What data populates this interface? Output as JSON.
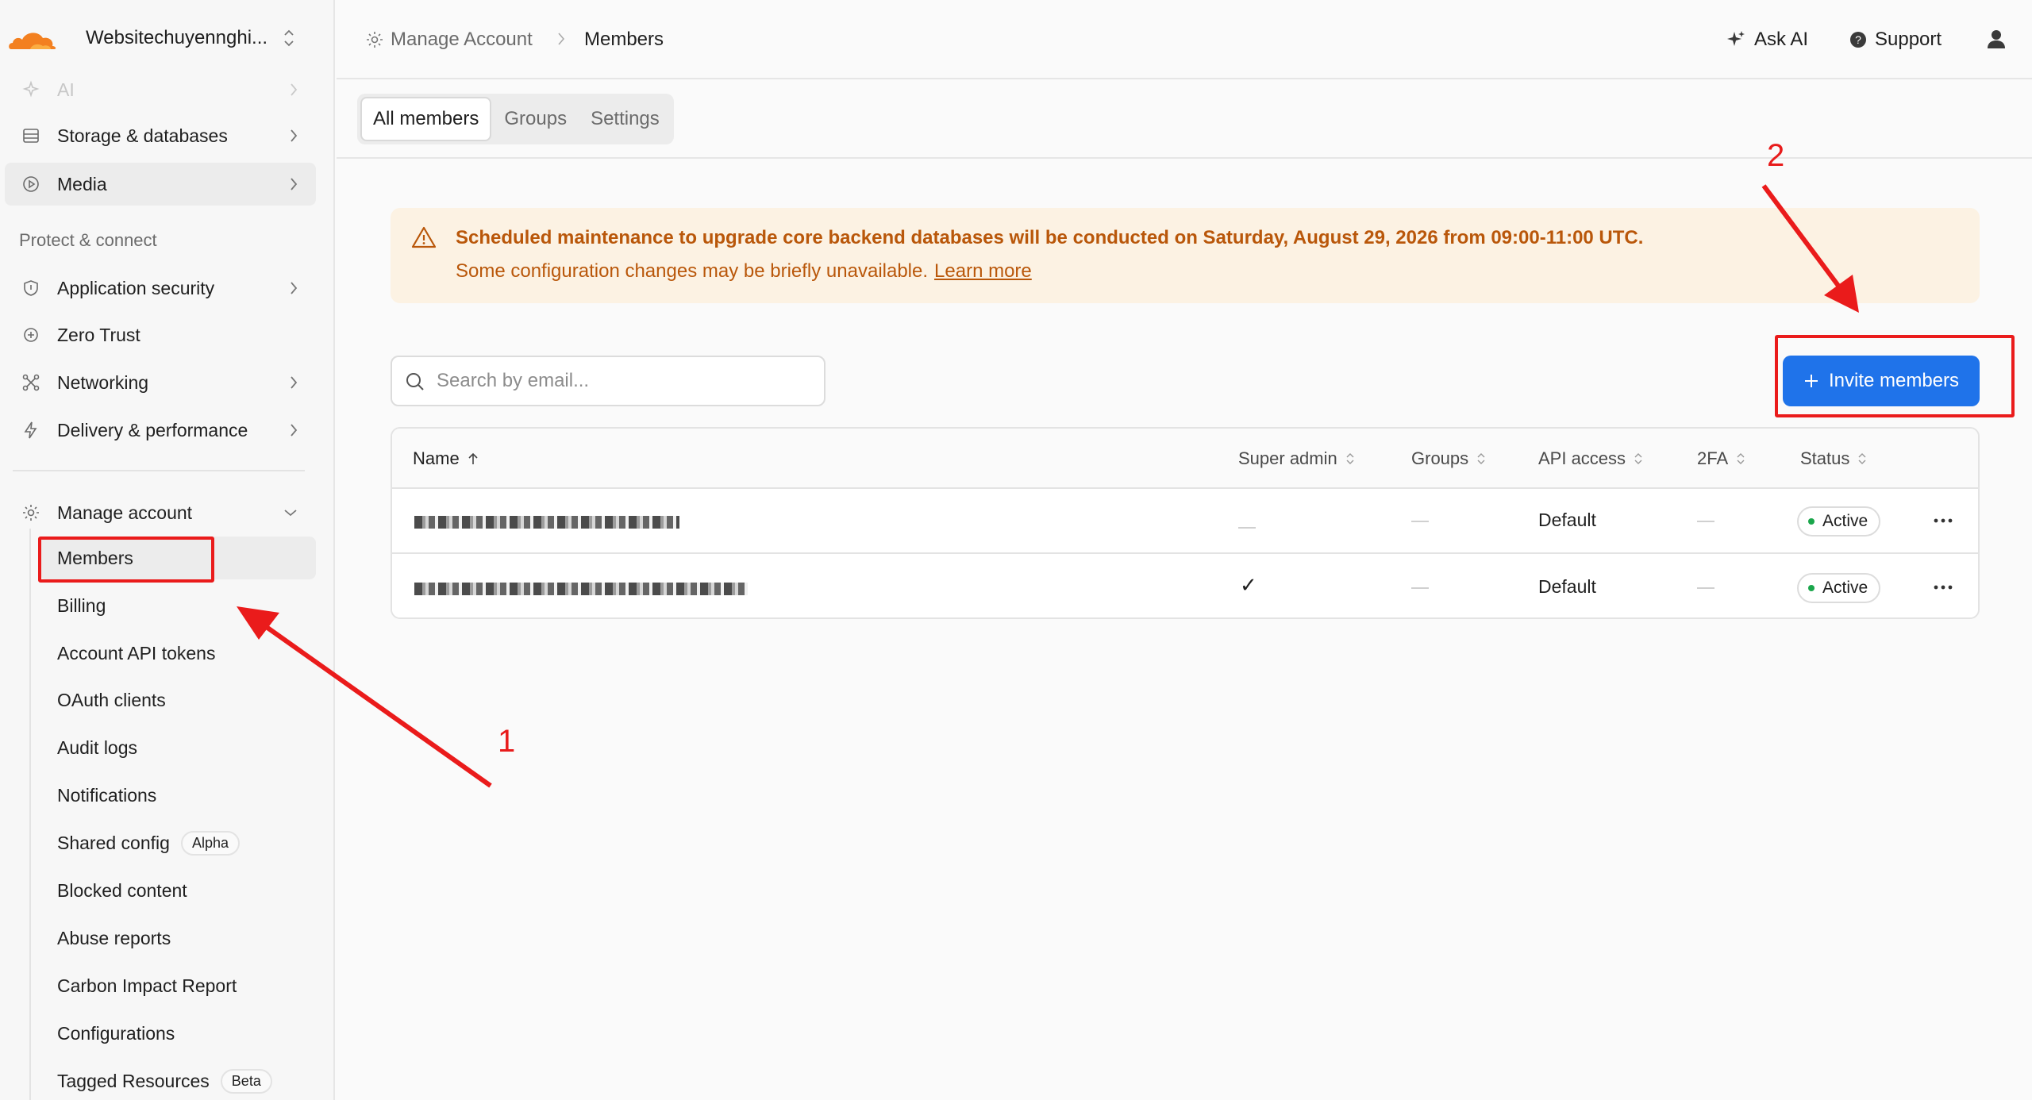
{
  "account": {
    "name": "Websitechuyennghi..."
  },
  "sidebar": {
    "top_items": [
      {
        "label": "AI",
        "icon": "sparkles-icon"
      },
      {
        "label": "Storage & databases",
        "icon": "database-icon"
      },
      {
        "label": "Media",
        "icon": "play-circle-icon"
      }
    ],
    "section_protect": "Protect & connect",
    "protect_items": [
      {
        "label": "Application security",
        "icon": "shield-icon"
      },
      {
        "label": "Zero Trust",
        "icon": "zero-trust-icon"
      },
      {
        "label": "Networking",
        "icon": "network-icon"
      },
      {
        "label": "Delivery & performance",
        "icon": "bolt-icon"
      }
    ],
    "manage": {
      "label": "Manage account",
      "icon": "gear-icon"
    },
    "manage_items": [
      {
        "label": "Members"
      },
      {
        "label": "Billing"
      },
      {
        "label": "Account API tokens"
      },
      {
        "label": "OAuth clients"
      },
      {
        "label": "Audit logs"
      },
      {
        "label": "Notifications"
      },
      {
        "label": "Shared config",
        "badge": "Alpha"
      },
      {
        "label": "Blocked content"
      },
      {
        "label": "Abuse reports"
      },
      {
        "label": "Carbon Impact Report"
      },
      {
        "label": "Configurations"
      },
      {
        "label": "Tagged Resources",
        "badge": "Beta"
      }
    ]
  },
  "header": {
    "breadcrumb": [
      "Manage Account",
      "Members"
    ],
    "ask_ai": "Ask AI",
    "support": "Support"
  },
  "tabs": [
    "All members",
    "Groups",
    "Settings"
  ],
  "banner": {
    "title": "Scheduled maintenance to upgrade core backend databases will be conducted on Saturday, August 29, 2026 from 09:00-11:00 UTC.",
    "body": "Some configuration changes may be briefly unavailable.",
    "link": "Learn more"
  },
  "search": {
    "placeholder": "Search by email...",
    "value": ""
  },
  "invite_button": "Invite members",
  "table": {
    "columns": [
      "Name",
      "Super admin",
      "Groups",
      "API access",
      "2FA",
      "Status"
    ],
    "rows": [
      {
        "super_admin": "",
        "api_access": "Default",
        "status": "Active"
      },
      {
        "super_admin": "✓",
        "api_access": "Default",
        "status": "Active"
      }
    ]
  },
  "annotations": {
    "one": "1",
    "two": "2"
  },
  "colors": {
    "accent": "#1f73ea",
    "brand": "#f38020",
    "warning_text": "#b9570a",
    "warning_bg": "#fcf2e3",
    "annotation": "#ea1b1b",
    "active_dot": "#1aa64b"
  }
}
